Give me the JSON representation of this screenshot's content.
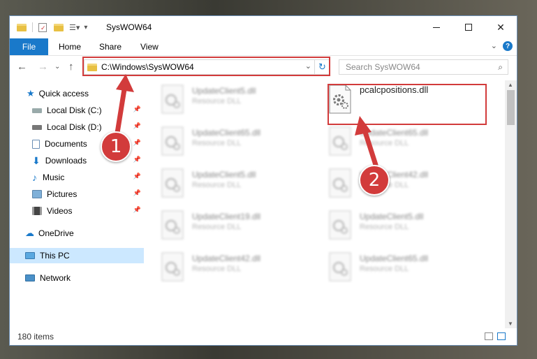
{
  "window": {
    "title": "SysWOW64"
  },
  "ribbon": {
    "file": "File",
    "home": "Home",
    "share": "Share",
    "view": "View",
    "help": "?"
  },
  "nav": {
    "address": "C:\\Windows\\SysWOW64",
    "search_placeholder": "Search SysWOW64"
  },
  "sidebar": {
    "items": [
      {
        "label": "Quick access",
        "icon": "star-icon"
      },
      {
        "label": "Local Disk (C:)",
        "icon": "drive-icon"
      },
      {
        "label": "Local Disk (D:)",
        "icon": "drive-icon"
      },
      {
        "label": "Documents",
        "icon": "documents-icon"
      },
      {
        "label": "Downloads",
        "icon": "download-icon"
      },
      {
        "label": "Music",
        "icon": "music-icon"
      },
      {
        "label": "Pictures",
        "icon": "pictures-icon"
      },
      {
        "label": "Videos",
        "icon": "videos-icon"
      },
      {
        "label": "OneDrive",
        "icon": "cloud-icon"
      },
      {
        "label": "This PC",
        "icon": "computer-icon"
      },
      {
        "label": "Network",
        "icon": "network-icon"
      }
    ]
  },
  "files": [
    {
      "name": "UpdateClient5.dll",
      "type": "Resource DLL"
    },
    {
      "name": "pcalcpositions.dll",
      "type": ""
    },
    {
      "name": "UpdateClient65.dll",
      "type": "Resource DLL"
    },
    {
      "name": "UpdateClient65.dll",
      "type": "Resource DLL"
    },
    {
      "name": "UpdateClient5.dll",
      "type": "Resource DLL"
    },
    {
      "name": "UpdateClient42.dll",
      "type": "Resource DLL"
    },
    {
      "name": "UpdateClient19.dll",
      "type": "Resource DLL"
    },
    {
      "name": "UpdateClient5.dll",
      "type": "Resource DLL"
    },
    {
      "name": "UpdateClient42.dll",
      "type": "Resource DLL"
    },
    {
      "name": "UpdateClient65.dll",
      "type": "Resource DLL"
    }
  ],
  "status": {
    "count": "180 items"
  },
  "callouts": {
    "one": "1",
    "two": "2"
  },
  "colors": {
    "accent": "#1979ca",
    "callout": "#d23b3b",
    "selected": "#cce8ff"
  }
}
